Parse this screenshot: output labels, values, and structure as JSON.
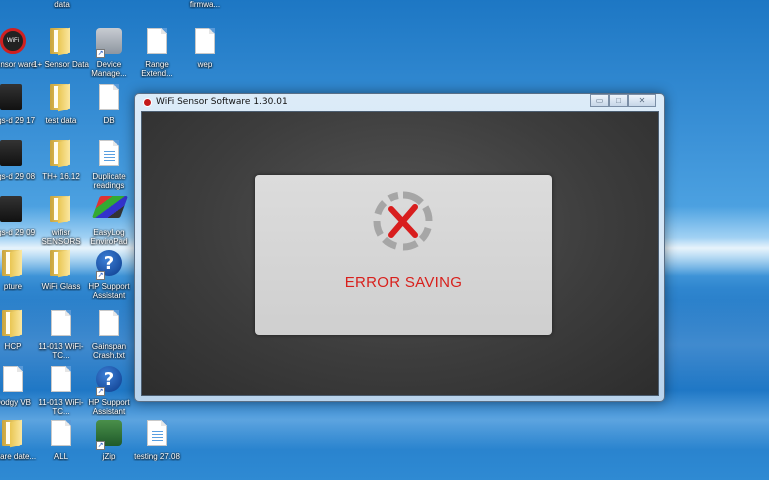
{
  "desktop": {
    "top_labels": [
      {
        "label": "data"
      },
      {
        "label": "firmwa..."
      }
    ],
    "icons": [
      {
        "label": "Sensor ware",
        "glyph": "wifi-round"
      },
      {
        "label": "1+ Sensor Data",
        "glyph": "folder"
      },
      {
        "label": "Device Manage...",
        "glyph": "gear"
      },
      {
        "label": "Range Extend...",
        "glyph": "doc"
      },
      {
        "label": "wep",
        "glyph": "doc"
      },
      {
        "label": "ings-d 29 17",
        "glyph": "dark"
      },
      {
        "label": "test data",
        "glyph": "folder"
      },
      {
        "label": "DB",
        "glyph": "doc"
      },
      {
        "label": "ings-d 29 08",
        "glyph": "dark"
      },
      {
        "label": "TH+ 16.12",
        "glyph": "folder"
      },
      {
        "label": "Duplicate readings",
        "glyph": "doc"
      },
      {
        "label": "ings-d 29 09",
        "glyph": "dark"
      },
      {
        "label": "wifisr SENSORS",
        "glyph": "folder"
      },
      {
        "label": "EasyLog EnviroPad",
        "glyph": "cube"
      },
      {
        "label": "pture",
        "glyph": "folder"
      },
      {
        "label": "WiFi Glass",
        "glyph": "folder"
      },
      {
        "label": "HP Support Assistant",
        "glyph": "help"
      },
      {
        "label": "HCP",
        "glyph": "folder"
      },
      {
        "label": "11-013 WiFi-TC...",
        "glyph": "doc"
      },
      {
        "label": "Gainspan Crash.txt",
        "glyph": "doc"
      },
      {
        "label": "Dodgy VB",
        "glyph": "doc"
      },
      {
        "label": "11-013 WiFi-TC...",
        "glyph": "doc"
      },
      {
        "label": "HP Support Assistant",
        "glyph": "help"
      },
      {
        "label": "nware date...",
        "glyph": "folder"
      },
      {
        "label": "ALL",
        "glyph": "doc"
      },
      {
        "label": "jZip",
        "glyph": "gear"
      },
      {
        "label": "testing 27.08",
        "glyph": "doc"
      }
    ]
  },
  "window": {
    "title": "WiFi Sensor Software 1.30.01",
    "controls": {
      "minimize": "▭",
      "maximize": "□",
      "close": "✕"
    }
  },
  "dialog": {
    "message": "ERROR SAVING",
    "icon": "error-x-icon",
    "accent_color": "#d8201c"
  }
}
